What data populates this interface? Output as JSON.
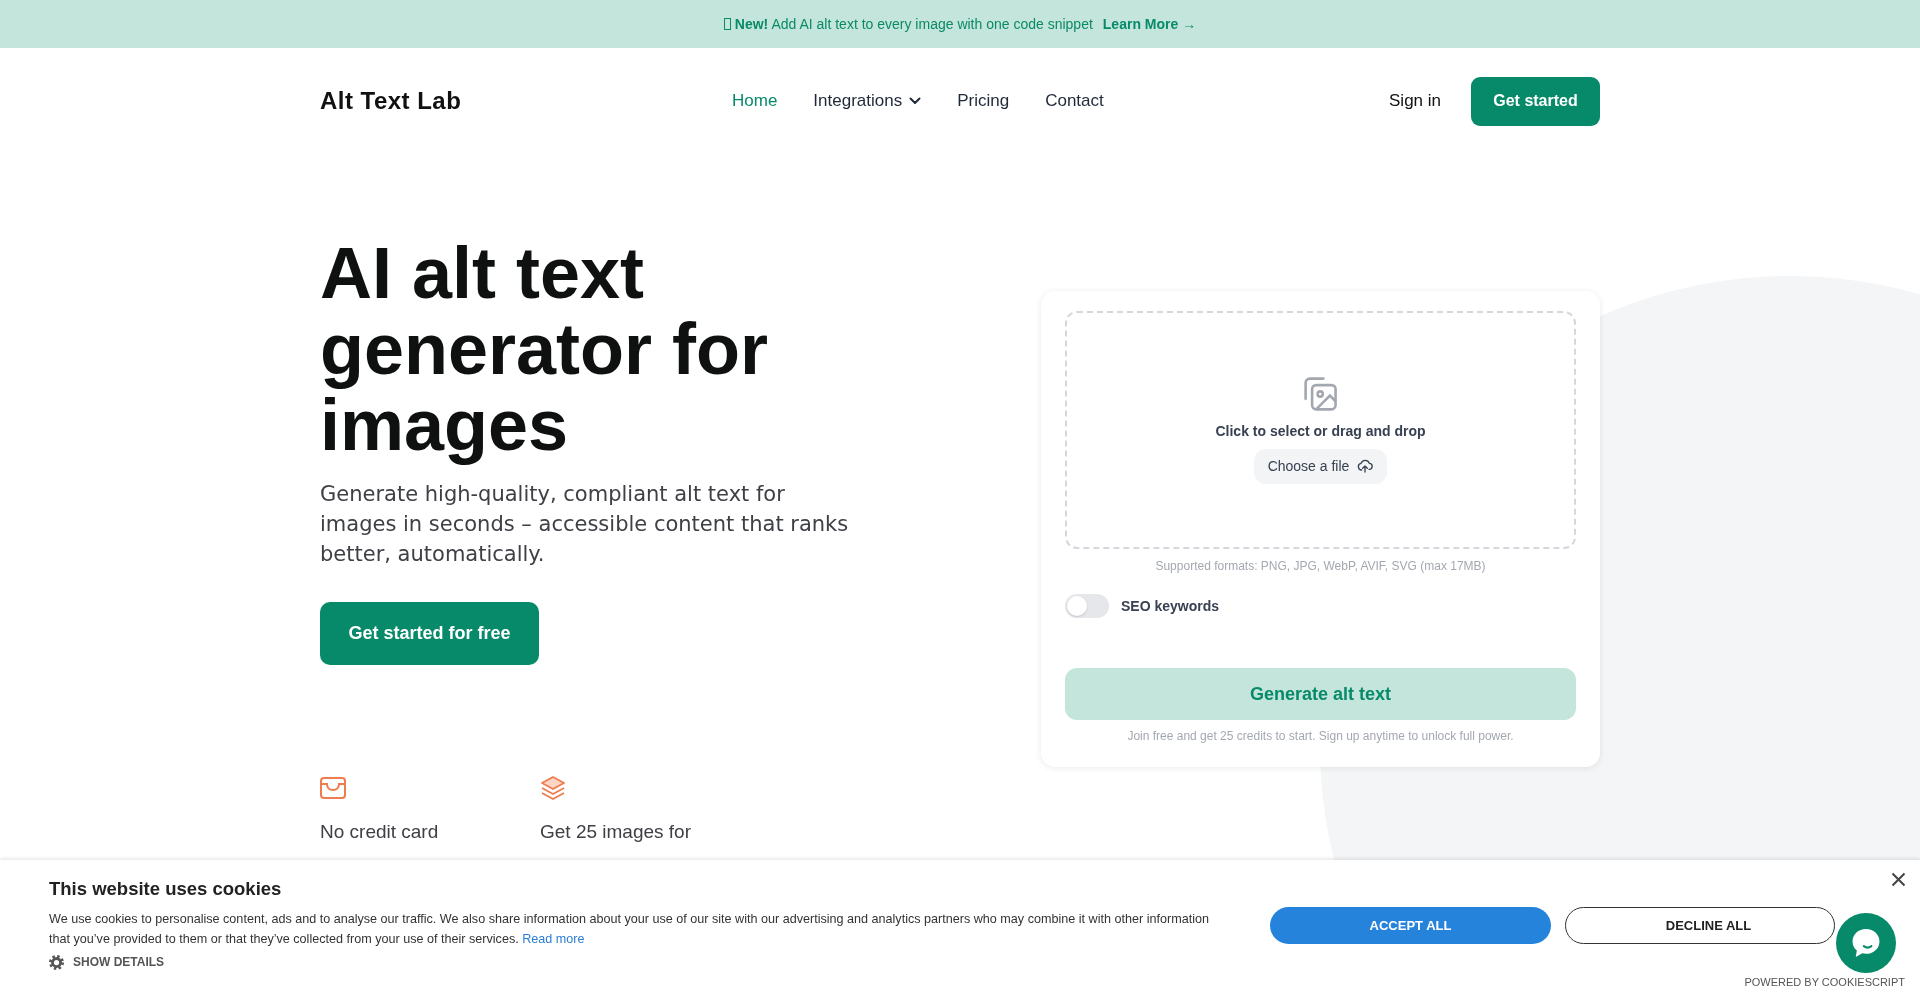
{
  "announcement": {
    "text": "**New!** Add AI alt text to every image with one code snippet",
    "link": "Learn More →"
  },
  "nav": {
    "logo": "Alt Text Lab",
    "links": [
      {
        "label": "Home",
        "selected": true,
        "dropdown": false
      },
      {
        "label": "Integrations",
        "selected": false,
        "dropdown": true
      },
      {
        "label": "Pricing",
        "selected": false,
        "dropdown": false
      },
      {
        "label": "Contact",
        "selected": false,
        "dropdown": false
      }
    ],
    "sign_in": "Sign in",
    "cta": "Get started"
  },
  "hero": {
    "title": "AI alt text generator for images",
    "subtitle": "Generate high-quality, compliant alt text for images in seconds – accessible content that ranks better, automatically.",
    "cta": "Get started for free",
    "features": [
      {
        "text": "No credit card"
      },
      {
        "text": "Get 25 images for"
      }
    ]
  },
  "uploader": {
    "prompt": "Click to select or drag and drop",
    "choose_button": "Choose a file",
    "formats_note": "Supported formats: PNG, JPG, WebP, AVIF, SVG (max 17MB)",
    "seo_toggle": {
      "label": "SEO keywords",
      "on": false
    },
    "generate_button": {
      "label": "Generate alt text",
      "disabled": true
    },
    "footnote": "Join free and get 25 credits to start. Sign up anytime to unlock full power."
  },
  "cookie_banner": {
    "title": "This website uses cookies",
    "text": "We use cookies to personalise content, ads and to analyse our traffic. We also share information about your use of our site with our advertising and analytics partners who may combine it with other information that you’ve provided to them or that they’ve collected from your use of their services.",
    "read_more": "Read more",
    "show_details": "SHOW DETAILS",
    "accept": "ACCEPT ALL",
    "decline": "DECLINE ALL",
    "powered_by": "POWERED BY COOKIESCRIPT"
  }
}
